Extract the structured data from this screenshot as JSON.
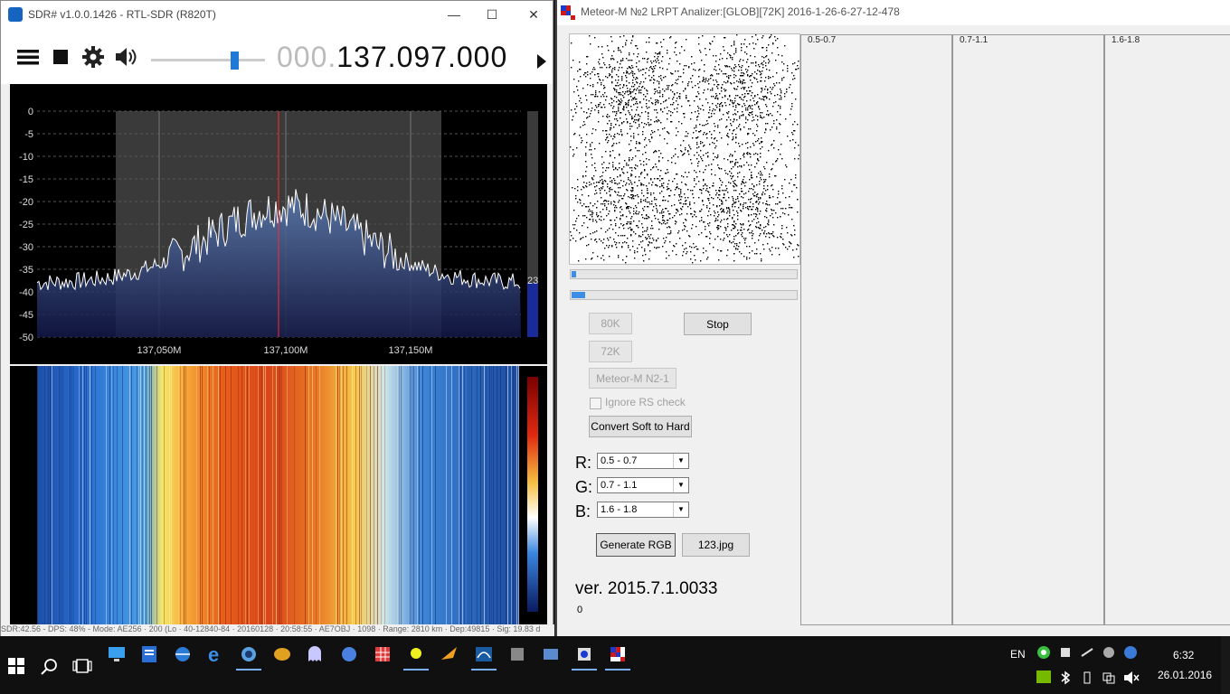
{
  "sdr": {
    "title": "SDR# v1.0.0.1426 - RTL-SDR (R820T)",
    "freq_dim": "000.",
    "freq_main": "137.097.000",
    "volume": 0.75,
    "y_ticks": [
      "0",
      "-5",
      "-10",
      "-15",
      "-20",
      "-25",
      "-30",
      "-35",
      "-40",
      "-45",
      "-50"
    ],
    "x_ticks": [
      "137,050M",
      "137,100M",
      "137,150M"
    ],
    "snr_value": "23",
    "status": "SDR:42.56 - DPS: 48% - Mode: AE256 · 200 (Lo · 40-12840-84 · 20160128 · 20:58:55 · AE7OBJ · 1098 · Range: 2810 km · Dep:49815 · Sig: 19.83 d"
  },
  "meteor": {
    "title": "Meteor-M №2 LRPT Analizer:[GLOB][72K] 2016-1-26-6-27-12-478",
    "progress1": 0.02,
    "progress2": 0.06,
    "btn_80k": "80K",
    "btn_72k": "72K",
    "btn_stop": "Stop",
    "btn_mode": "Meteor-M N2-1",
    "chk_rs": "Ignore RS check",
    "btn_convert": "Convert Soft to Hard",
    "lbl_r": "R:",
    "lbl_g": "G:",
    "lbl_b": "B:",
    "combo_r": "0.5 - 0.7",
    "combo_g": "0.7 - 1.1",
    "combo_b": "1.6 - 1.8",
    "btn_generate": "Generate RGB",
    "btn_jpg": "123.jpg",
    "version": "ver. 2015.7.1.0033",
    "counter": "0",
    "panels": [
      "0.5-0.7",
      "0.7-1.1",
      "1.6-1.8"
    ]
  },
  "taskbar": {
    "lang": "EN",
    "time": "6:32",
    "date": "26.01.2016"
  }
}
